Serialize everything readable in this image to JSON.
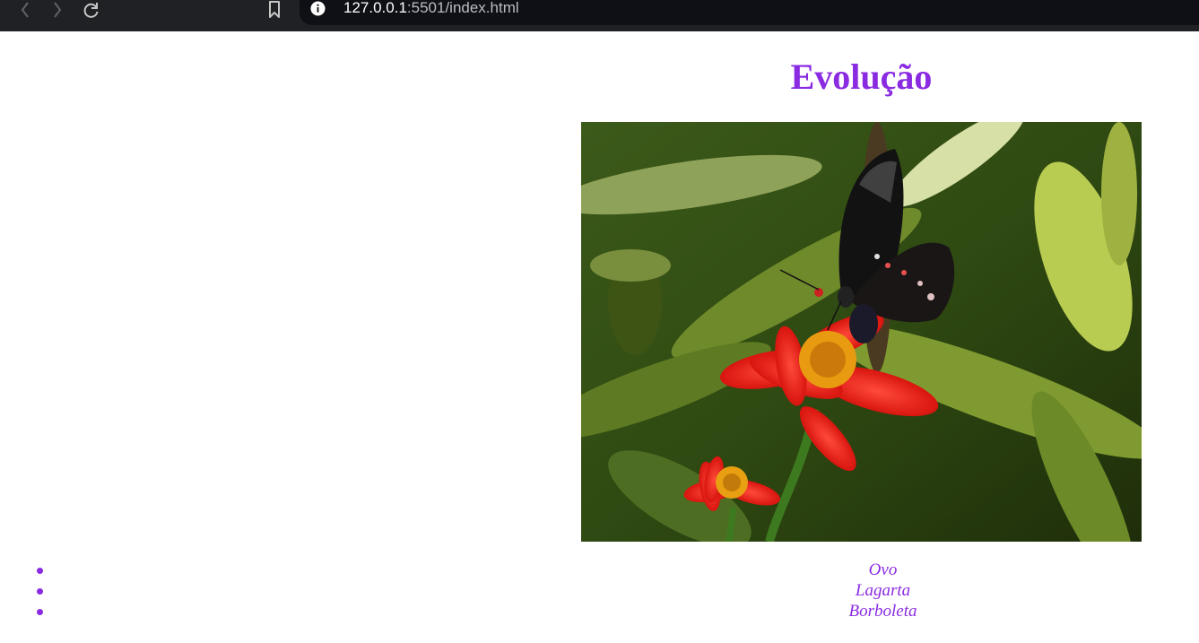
{
  "browser": {
    "url_host": "127.0.0.1",
    "url_rest": ":5501/index.html",
    "icons": {
      "back": "chevron-left-icon",
      "forward": "chevron-right-icon",
      "reload": "reload-icon",
      "bookmark": "bookmark-icon",
      "site_info": "info-icon"
    },
    "chrome_color": "#202124",
    "omnibox_color": "#0f1015"
  },
  "page": {
    "title": "Evolução",
    "accent_color": "#8a2be2",
    "photo_alt": "Borboleta",
    "stages": [
      {
        "label": "Ovo"
      },
      {
        "label": "Lagarta"
      },
      {
        "label": "Borboleta"
      }
    ]
  }
}
